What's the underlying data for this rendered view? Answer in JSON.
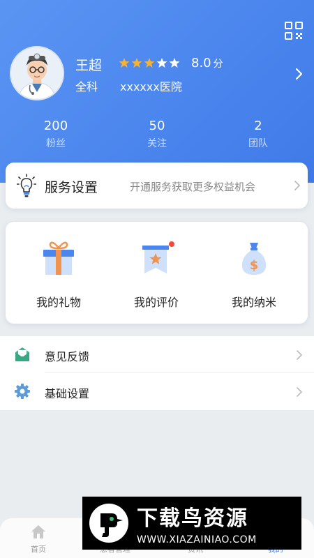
{
  "profile": {
    "name": "王超",
    "rating_stars": 5,
    "score": "8.0",
    "score_unit": "分",
    "department": "全科",
    "hospital": "xxxxxx医院"
  },
  "stats": [
    {
      "value": "200",
      "label": "粉丝"
    },
    {
      "value": "50",
      "label": "关注"
    },
    {
      "value": "2",
      "label": "团队"
    }
  ],
  "service": {
    "title": "服务设置",
    "description": "开通服务获取更多权益机会"
  },
  "quick_actions": [
    {
      "label": "我的礼物",
      "icon": "gift-icon"
    },
    {
      "label": "我的评价",
      "icon": "review-badge-icon"
    },
    {
      "label": "我的纳米",
      "icon": "money-bag-icon"
    }
  ],
  "menu": [
    {
      "label": "意见反馈",
      "icon": "feedback-envelope-icon"
    },
    {
      "label": "基础设置",
      "icon": "gear-icon"
    }
  ],
  "tabbar": {
    "tabs": [
      {
        "label": "首页",
        "icon": "home-icon"
      },
      {
        "label": "患者管理",
        "icon": "patients-icon"
      },
      {
        "label": "资讯",
        "icon": "news-icon"
      },
      {
        "label": "我的",
        "icon": "profile-icon"
      }
    ],
    "active_index": 3
  },
  "watermark": {
    "title": "下载鸟资源",
    "url": "WWW.XIAZAINIAO.COM"
  },
  "colors": {
    "header_blue": "#4b86ee",
    "star_gold": "#f5b335",
    "gift_orange": "#f0934e",
    "notification_red": "#f04a3e"
  }
}
